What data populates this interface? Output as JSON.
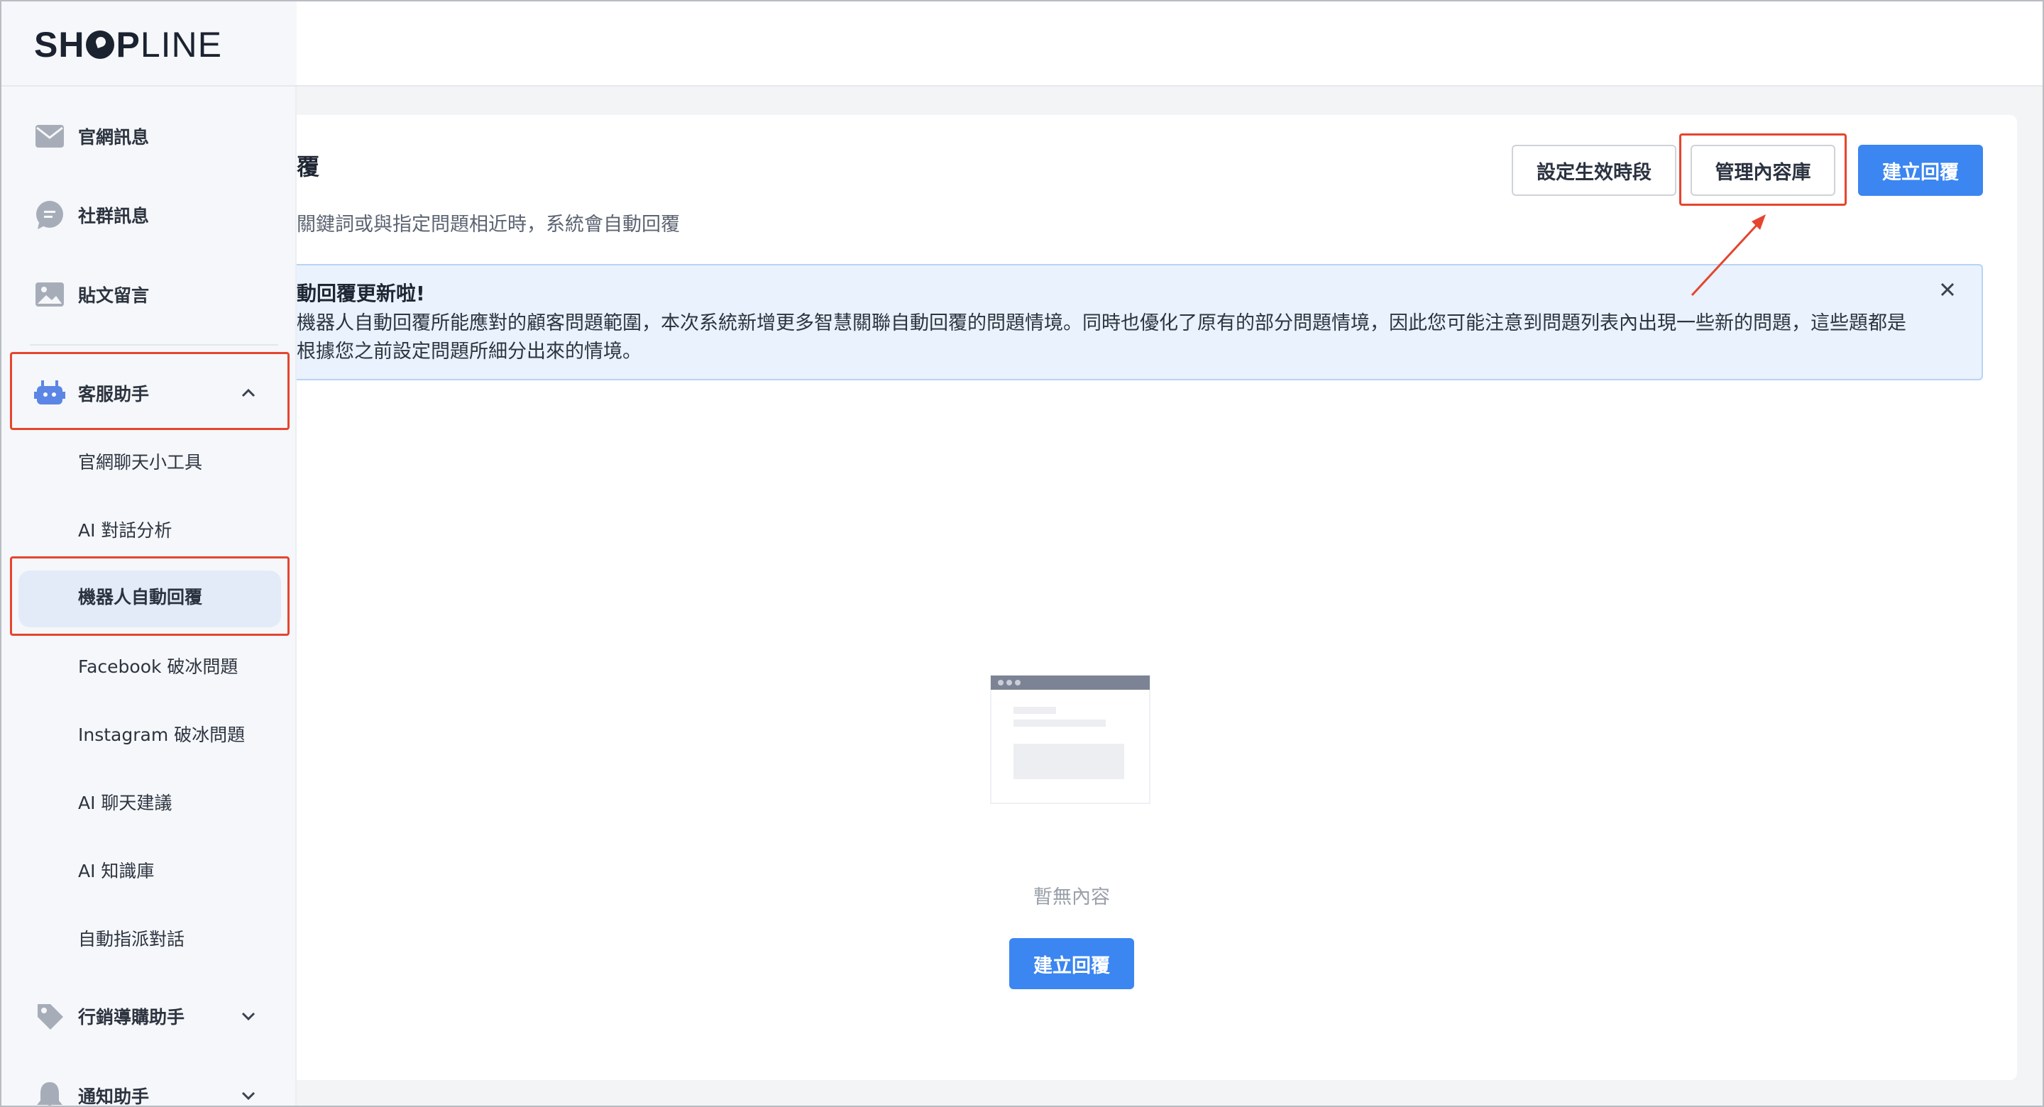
{
  "brand": {
    "logo_bold": "SH",
    "logo_bold2": "P",
    "logo_light": "LINE"
  },
  "sidebar": {
    "items": [
      {
        "label": "官網訊息",
        "icon": "envelope-icon"
      },
      {
        "label": "社群訊息",
        "icon": "chat-bubble-icon"
      },
      {
        "label": "貼文留言",
        "icon": "image-icon"
      }
    ],
    "section": {
      "label": "客服助手",
      "icon": "robot-icon",
      "expanded": true
    },
    "sub_items": [
      {
        "label": "官網聊天小工具"
      },
      {
        "label": "AI 對話分析"
      },
      {
        "label": "機器人自動回覆",
        "active": true
      },
      {
        "label": "Facebook 破冰問題"
      },
      {
        "label": "Instagram 破冰問題"
      },
      {
        "label": "AI 聊天建議"
      },
      {
        "label": "AI 知識庫"
      },
      {
        "label": "自動指派對話"
      }
    ],
    "collapsed_sections": [
      {
        "label": "行銷導購助手",
        "icon": "tag-icon"
      },
      {
        "label": "通知助手",
        "icon": "bell-icon"
      }
    ]
  },
  "main": {
    "title": "覆",
    "description": "關鍵詞或與指定問題相近時，系統會自動回覆",
    "buttons": {
      "schedule": "設定生效時段",
      "manage": "管理內容庫",
      "create": "建立回覆"
    },
    "notice": {
      "title": "動回覆更新啦!",
      "body": "機器人自動回覆所能應對的顧客問題範圍，本次系統新增更多智慧關聯自動回覆的問題情境。同時也優化了原有的部分問題情境，因此您可能注意到問題列表內出現一些新的問題，這些題都是根據您之前設定問題所細分出來的情境。"
    },
    "empty": {
      "text": "暫無內容",
      "button": "建立回覆"
    }
  },
  "colors": {
    "primary": "#3b86f0",
    "highlight_box": "#e5452f",
    "active_pill": "#e4ebf8",
    "notice_bg": "#e9f2fd"
  }
}
